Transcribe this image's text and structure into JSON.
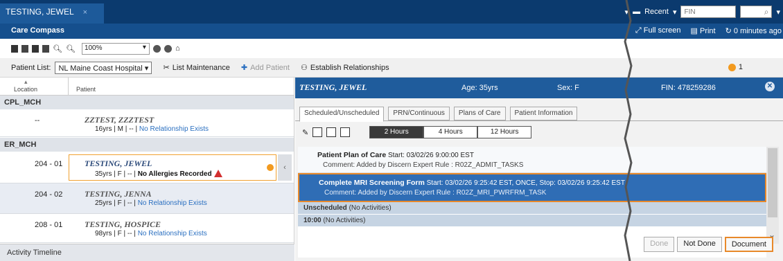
{
  "tab": {
    "title": "TESTING, JEWEL",
    "close": "×"
  },
  "topbar": {
    "recent": "Recent",
    "fin_placeholder": "FIN"
  },
  "subbar": {
    "title": "Care Compass",
    "full_screen": "Full screen",
    "print": "Print",
    "refresh": "0 minutes ago"
  },
  "toolbar": {
    "zoom": "100%"
  },
  "patient_list": {
    "label": "Patient List:",
    "selected": "NL Maine Coast Hospital",
    "list_maintenance": "List Maintenance",
    "add_patient": "Add Patient",
    "establish": "Establish Relationships",
    "alert_count": "1"
  },
  "columns": {
    "location": "Location",
    "patient": "Patient"
  },
  "groups": {
    "g1": "CPL_MCH",
    "g2": "ER_MCH"
  },
  "patients": [
    {
      "location": "--",
      "name": "ZZTEST, ZZZTEST",
      "info": "16yrs | M | --",
      "link": "No Relationship Exists"
    },
    {
      "location": "204 - 01",
      "name": "TESTING, JEWEL",
      "info": "35yrs | F | --",
      "alert": "No Allergies Recorded"
    },
    {
      "location": "204 - 02",
      "name": "TESTING, JENNA",
      "info": "25yrs | F | --",
      "link": "No Relationship Exists"
    },
    {
      "location": "208 - 01",
      "name": "TESTING, HOSPICE",
      "info": "98yrs | F | --",
      "link": "No Relationship Exists"
    }
  ],
  "activity_timeline": "Activity Timeline",
  "detail": {
    "name": "TESTING, JEWEL",
    "age": "Age: 35yrs",
    "sex": "Sex: F",
    "fin": "FIN: 478259286",
    "tabs": [
      "Scheduled/Unscheduled",
      "PRN/Continuous",
      "Plans of Care",
      "Patient Information"
    ],
    "hours": [
      "2 Hours",
      "4 Hours",
      "12 Hours"
    ],
    "tasks": [
      {
        "title": "Patient Plan of Care",
        "detail": " Start: 03/02/26 9:00:00 EST",
        "comment": "Comment: Added by Discern Expert Rule : R02Z_ADMIT_TASKS"
      },
      {
        "title": "Complete MRI Screening Form",
        "detail": " Start: 03/02/26 9:25:42 EST, ONCE, Stop: 03/02/26 9:25:42 EST",
        "comment": "Comment: Added by Discern Expert Rule : R02Z_MRI_PWRFRM_TASK"
      }
    ],
    "unscheduled_label": "Unscheduled",
    "unscheduled_note": " (No Activities)",
    "time_label": "10:00",
    "time_note": " (No Activities)",
    "buttons": {
      "done": "Done",
      "not_done": "Not Done",
      "document": "Document"
    }
  },
  "colors": {
    "brand": "#0b3a6e",
    "header": "#1f5c9c",
    "selected_task": "#2f6db5",
    "accent": "#e8892a"
  }
}
